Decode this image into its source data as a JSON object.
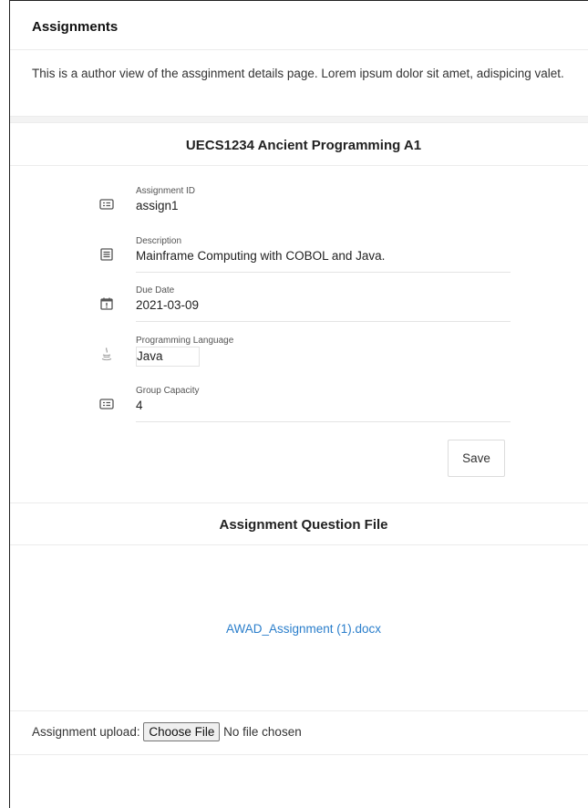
{
  "header": {
    "title": "Assignments"
  },
  "intro": {
    "text": "This is a author view of the assginment details page. Lorem ipsum dolor sit amet, adispicing valet."
  },
  "assignment": {
    "course_title": "UECS1234 Ancient Programming A1",
    "fields": {
      "id": {
        "label": "Assignment ID",
        "value": "assign1",
        "icon": "id-card-icon"
      },
      "description": {
        "label": "Description",
        "value": "Mainframe Computing with COBOL and Java.",
        "icon": "document-icon"
      },
      "due_date": {
        "label": "Due Date",
        "value": "2021-03-09",
        "icon": "calendar-alert-icon"
      },
      "language": {
        "label": "Programming Language",
        "value": "Java",
        "icon": "java-icon"
      },
      "group_capacity": {
        "label": "Group Capacity",
        "value": "4",
        "icon": "id-card-icon"
      }
    },
    "save_label": "Save"
  },
  "question_file": {
    "title": "Assignment Question File",
    "file_name": "AWAD_Assignment (1).docx"
  },
  "upload": {
    "label": "Assignment upload:",
    "button_label": "Choose File",
    "status": "No file chosen"
  },
  "colors": {
    "link": "#2a7ecb",
    "text": "#222222",
    "divider": "#ececec"
  }
}
